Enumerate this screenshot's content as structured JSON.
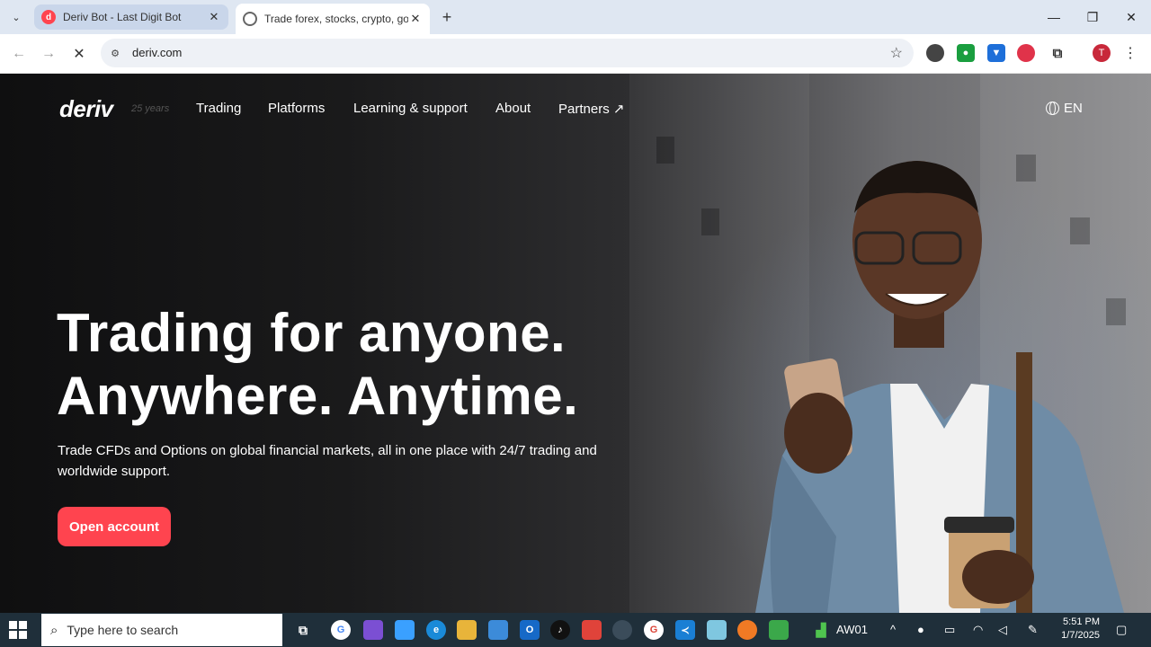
{
  "browser": {
    "tabs": [
      {
        "title": "Deriv Bot - Last Digit Bot",
        "favicon": "deriv-icon",
        "active": false
      },
      {
        "title": "Trade forex, stocks, crypto, gold",
        "favicon": "loading-icon",
        "active": true
      }
    ],
    "url": "deriv.com",
    "profile_initial": "T"
  },
  "site": {
    "logo": "deriv",
    "logo_years": "25 years",
    "nav": [
      "Trading",
      "Platforms",
      "Learning & support",
      "About",
      "Partners ↗"
    ],
    "language": "EN",
    "hero_line1": "Trading for anyone.",
    "hero_line2": "Anywhere. Anytime.",
    "hero_sub": "Trade CFDs and Options on global financial markets, all in one place with 24/7 trading and worldwide support.",
    "cta": "Open account",
    "accent": "#ff444f"
  },
  "taskbar": {
    "search_placeholder": "Type here to search",
    "tray_label": "AW01",
    "time": "5:51 PM",
    "date": "1/7/2025"
  }
}
